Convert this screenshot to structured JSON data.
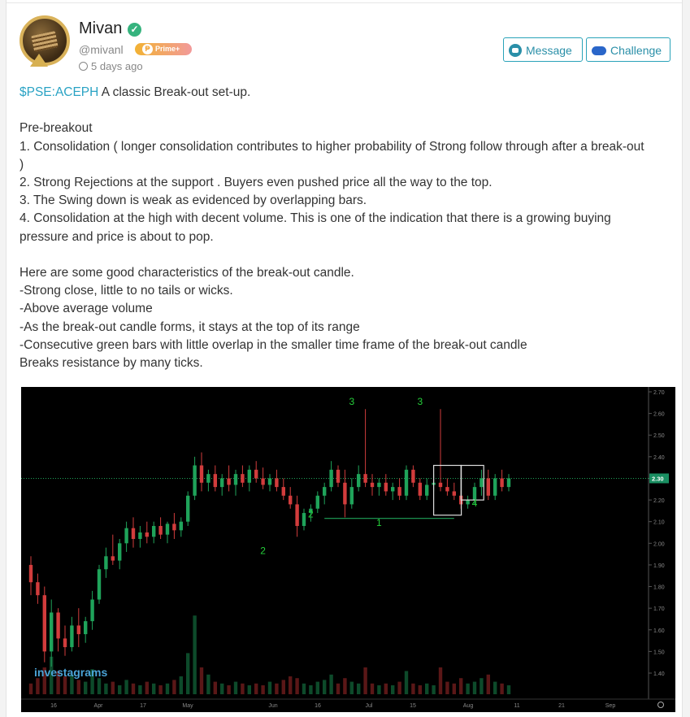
{
  "user": {
    "name": "Mivan",
    "handle": "@mivanl",
    "badge": "Prime+",
    "posted": "5 days ago"
  },
  "actions": {
    "message_label": "Message",
    "challenge_label": "Challenge"
  },
  "post": {
    "ticker": "$PSE:ACEPH",
    "intro": " A classic Break-out set-up.",
    "lines": [
      "",
      "Pre-breakout",
      "1. Consolidation ( longer consolidation contributes to higher probability of Strong follow through after a break-out",
      ")",
      "2. Strong Rejections at the support . Buyers even pushed price all the way to the top.",
      "3. The Swing down is weak as evidenced by overlapping bars.",
      "4. Consolidation at the high with decent volume. This is one of the indication that there is a growing buying",
      "pressure and price is about to pop.",
      "",
      "Here are some good characteristics of the break-out candle.",
      "-Strong close, little to no tails or wicks.",
      "-Above average volume",
      "-As the break-out candle forms, it stays at the top of its range",
      "-Consecutive green bars with little overlap in the smaller time frame of the break-out candle",
      "Breaks resistance by many ticks."
    ]
  },
  "chart_data": {
    "type": "candlestick",
    "watermark": "investagrams",
    "current_price": "2.30",
    "y_ticks": [
      "2.70",
      "2.60",
      "2.50",
      "2.40",
      "2.30",
      "2.20",
      "2.10",
      "2.00",
      "1.90",
      "1.80",
      "1.70",
      "1.60",
      "1.50",
      "1.40"
    ],
    "x_ticks": [
      "16",
      "Apr",
      "17",
      "May",
      "Jun",
      "16",
      "Jul",
      "15",
      "Aug",
      "11",
      "21",
      "Sep"
    ],
    "annotations": [
      "3",
      "3",
      "2",
      "2",
      "1",
      "4"
    ],
    "colors": {
      "up": "#1fa35a",
      "down": "#d23c3c",
      "label": "#25d03a",
      "line": "#1fa35a"
    },
    "candles": [
      {
        "o": 1.9,
        "h": 1.94,
        "l": 1.76,
        "c": 1.82
      },
      {
        "o": 1.82,
        "h": 1.86,
        "l": 1.72,
        "c": 1.76
      },
      {
        "o": 1.76,
        "h": 1.8,
        "l": 1.45,
        "c": 1.5
      },
      {
        "o": 1.5,
        "h": 1.74,
        "l": 1.43,
        "c": 1.68
      },
      {
        "o": 1.68,
        "h": 1.7,
        "l": 1.5,
        "c": 1.56
      },
      {
        "o": 1.56,
        "h": 1.62,
        "l": 1.48,
        "c": 1.52
      },
      {
        "o": 1.52,
        "h": 1.66,
        "l": 1.5,
        "c": 1.62
      },
      {
        "o": 1.62,
        "h": 1.7,
        "l": 1.52,
        "c": 1.58
      },
      {
        "o": 1.58,
        "h": 1.66,
        "l": 1.54,
        "c": 1.64
      },
      {
        "o": 1.64,
        "h": 1.78,
        "l": 1.6,
        "c": 1.74
      },
      {
        "o": 1.74,
        "h": 1.9,
        "l": 1.72,
        "c": 1.88
      },
      {
        "o": 1.88,
        "h": 1.98,
        "l": 1.84,
        "c": 1.94
      },
      {
        "o": 1.94,
        "h": 2.04,
        "l": 1.9,
        "c": 1.92
      },
      {
        "o": 1.92,
        "h": 2.02,
        "l": 1.88,
        "c": 2.0
      },
      {
        "o": 2.0,
        "h": 2.1,
        "l": 1.96,
        "c": 2.07
      },
      {
        "o": 2.07,
        "h": 2.12,
        "l": 1.98,
        "c": 2.02
      },
      {
        "o": 2.02,
        "h": 2.08,
        "l": 1.98,
        "c": 2.05
      },
      {
        "o": 2.05,
        "h": 2.1,
        "l": 2.0,
        "c": 2.03
      },
      {
        "o": 2.03,
        "h": 2.1,
        "l": 2.0,
        "c": 2.08
      },
      {
        "o": 2.08,
        "h": 2.12,
        "l": 2.02,
        "c": 2.04
      },
      {
        "o": 2.04,
        "h": 2.1,
        "l": 2.0,
        "c": 2.09
      },
      {
        "o": 2.09,
        "h": 2.14,
        "l": 2.02,
        "c": 2.06
      },
      {
        "o": 2.06,
        "h": 2.12,
        "l": 2.03,
        "c": 2.1
      },
      {
        "o": 2.1,
        "h": 2.24,
        "l": 2.08,
        "c": 2.22
      },
      {
        "o": 2.22,
        "h": 2.4,
        "l": 2.2,
        "c": 2.36
      },
      {
        "o": 2.36,
        "h": 2.42,
        "l": 2.24,
        "c": 2.28
      },
      {
        "o": 2.28,
        "h": 2.34,
        "l": 2.24,
        "c": 2.32
      },
      {
        "o": 2.32,
        "h": 2.36,
        "l": 2.24,
        "c": 2.26
      },
      {
        "o": 2.26,
        "h": 2.32,
        "l": 2.22,
        "c": 2.3
      },
      {
        "o": 2.3,
        "h": 2.36,
        "l": 2.24,
        "c": 2.27
      },
      {
        "o": 2.27,
        "h": 2.34,
        "l": 2.22,
        "c": 2.32
      },
      {
        "o": 2.32,
        "h": 2.36,
        "l": 2.26,
        "c": 2.28
      },
      {
        "o": 2.28,
        "h": 2.36,
        "l": 2.24,
        "c": 2.34
      },
      {
        "o": 2.34,
        "h": 2.38,
        "l": 2.28,
        "c": 2.3
      },
      {
        "o": 2.3,
        "h": 2.35,
        "l": 2.25,
        "c": 2.27
      },
      {
        "o": 2.27,
        "h": 2.32,
        "l": 2.24,
        "c": 2.3
      },
      {
        "o": 2.3,
        "h": 2.34,
        "l": 2.24,
        "c": 2.26
      },
      {
        "o": 2.26,
        "h": 2.3,
        "l": 2.2,
        "c": 2.22
      },
      {
        "o": 2.22,
        "h": 2.26,
        "l": 2.16,
        "c": 2.18
      },
      {
        "o": 2.18,
        "h": 2.22,
        "l": 2.03,
        "c": 2.08
      },
      {
        "o": 2.08,
        "h": 2.16,
        "l": 2.06,
        "c": 2.14
      },
      {
        "o": 2.14,
        "h": 2.18,
        "l": 2.1,
        "c": 2.16
      },
      {
        "o": 2.16,
        "h": 2.24,
        "l": 2.14,
        "c": 2.22
      },
      {
        "o": 2.22,
        "h": 2.28,
        "l": 2.18,
        "c": 2.26
      },
      {
        "o": 2.26,
        "h": 2.38,
        "l": 2.24,
        "c": 2.34
      },
      {
        "o": 2.34,
        "h": 2.36,
        "l": 2.26,
        "c": 2.28
      },
      {
        "o": 2.28,
        "h": 2.34,
        "l": 2.12,
        "c": 2.18
      },
      {
        "o": 2.18,
        "h": 2.3,
        "l": 2.16,
        "c": 2.26
      },
      {
        "o": 2.26,
        "h": 2.36,
        "l": 2.24,
        "c": 2.32
      },
      {
        "o": 2.32,
        "h": 2.62,
        "l": 2.26,
        "c": 2.28
      },
      {
        "o": 2.28,
        "h": 2.32,
        "l": 2.22,
        "c": 2.26
      },
      {
        "o": 2.26,
        "h": 2.3,
        "l": 2.22,
        "c": 2.28
      },
      {
        "o": 2.28,
        "h": 2.32,
        "l": 2.22,
        "c": 2.24
      },
      {
        "o": 2.24,
        "h": 2.28,
        "l": 2.2,
        "c": 2.26
      },
      {
        "o": 2.26,
        "h": 2.3,
        "l": 2.2,
        "c": 2.22
      },
      {
        "o": 2.22,
        "h": 2.36,
        "l": 2.2,
        "c": 2.34
      },
      {
        "o": 2.34,
        "h": 2.36,
        "l": 2.26,
        "c": 2.28
      },
      {
        "o": 2.28,
        "h": 2.3,
        "l": 2.2,
        "c": 2.22
      },
      {
        "o": 2.22,
        "h": 2.3,
        "l": 2.2,
        "c": 2.27
      },
      {
        "o": 2.27,
        "h": 2.32,
        "l": 2.24,
        "c": 2.28
      },
      {
        "o": 2.28,
        "h": 2.62,
        "l": 2.24,
        "c": 2.26
      },
      {
        "o": 2.26,
        "h": 2.3,
        "l": 2.22,
        "c": 2.24
      },
      {
        "o": 2.24,
        "h": 2.28,
        "l": 2.2,
        "c": 2.22
      },
      {
        "o": 2.22,
        "h": 2.24,
        "l": 2.16,
        "c": 2.18
      },
      {
        "o": 2.18,
        "h": 2.22,
        "l": 2.16,
        "c": 2.2
      },
      {
        "o": 2.2,
        "h": 2.28,
        "l": 2.18,
        "c": 2.26
      },
      {
        "o": 2.26,
        "h": 2.34,
        "l": 2.22,
        "c": 2.3
      },
      {
        "o": 2.3,
        "h": 2.34,
        "l": 2.2,
        "c": 2.22
      },
      {
        "o": 2.22,
        "h": 2.32,
        "l": 2.2,
        "c": 2.3
      },
      {
        "o": 2.3,
        "h": 2.34,
        "l": 2.24,
        "c": 2.26
      },
      {
        "o": 2.26,
        "h": 2.32,
        "l": 2.24,
        "c": 2.3
      }
    ],
    "volumes": [
      0.12,
      0.18,
      0.3,
      0.42,
      0.26,
      0.2,
      0.22,
      0.16,
      0.14,
      0.28,
      0.18,
      0.12,
      0.14,
      0.1,
      0.16,
      0.12,
      0.1,
      0.14,
      0.12,
      0.1,
      0.12,
      0.16,
      0.2,
      0.46,
      0.88,
      0.3,
      0.22,
      0.14,
      0.12,
      0.1,
      0.14,
      0.12,
      0.1,
      0.12,
      0.1,
      0.14,
      0.12,
      0.16,
      0.2,
      0.18,
      0.12,
      0.1,
      0.14,
      0.16,
      0.22,
      0.12,
      0.18,
      0.14,
      0.12,
      0.3,
      0.12,
      0.1,
      0.12,
      0.1,
      0.14,
      0.26,
      0.12,
      0.1,
      0.12,
      0.1,
      0.3,
      0.14,
      0.12,
      0.18,
      0.12,
      0.14,
      0.18,
      0.22,
      0.14,
      0.12,
      0.1
    ]
  }
}
